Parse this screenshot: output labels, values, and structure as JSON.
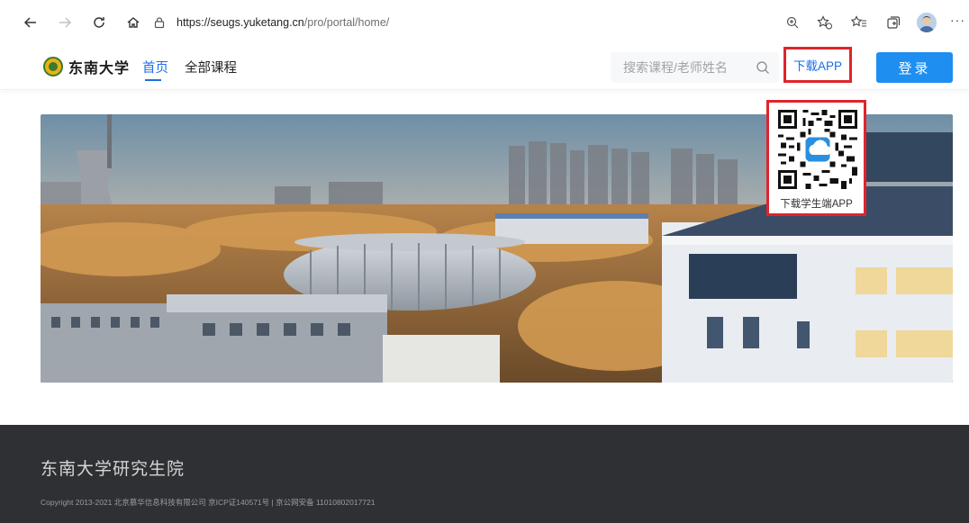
{
  "browser": {
    "url_host": "https://seugs.yuketang.cn",
    "url_path": "/pro/portal/home/",
    "back_icon": "arrow-left-icon",
    "forward_icon": "arrow-right-icon",
    "refresh_icon": "refresh-icon",
    "home_icon": "home-icon"
  },
  "header": {
    "logo_text": "东南大学",
    "nav": [
      {
        "label": "首页",
        "active": true
      },
      {
        "label": "全部课程",
        "active": false
      }
    ],
    "search_placeholder": "搜索课程/老师姓名",
    "download_label": "下载APP",
    "login_label": "登录"
  },
  "qr_popup": {
    "caption": "下载学生端APP"
  },
  "footer": {
    "title": "东南大学研究生院",
    "copyright": "Copyright 2013-2021 北京慕华信息科技有限公司 京ICP证140571号 | 京公网安备 11010802017721"
  },
  "colors": {
    "accent": "#1e6ee6",
    "login_bg": "#1e8ef0",
    "highlight_border": "#e0242a",
    "footer_bg": "#2f3033"
  }
}
